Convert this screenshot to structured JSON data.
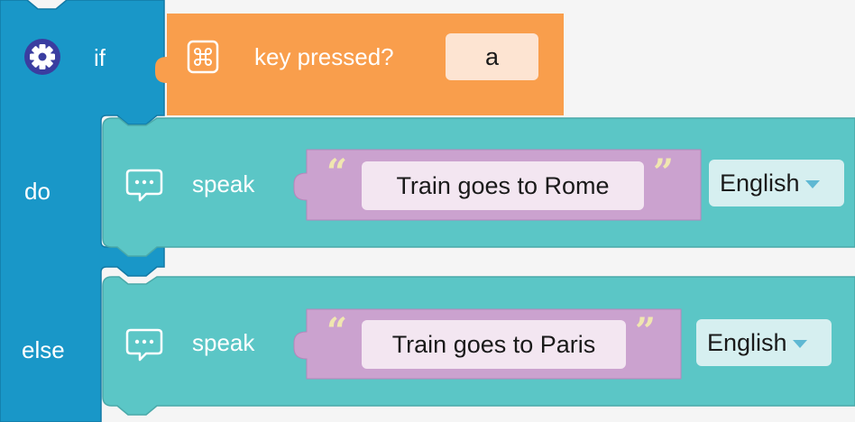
{
  "colors": {
    "workspace": "#f5f5f5",
    "if_block": "#1997c8",
    "if_block_dark": "#127aa6",
    "sensor_block": "#f99e4c",
    "sensor_field": "#fde4d2",
    "speak_block": "#5bc6c6",
    "speak_block_dark": "#4aa9a9",
    "text_block": "#cba2cf",
    "text_block_dark": "#b685bb",
    "text_field": "#f3e6f1",
    "dropdown_field": "#d6eff0"
  },
  "if_block": {
    "if_label": "if",
    "do_label": "do",
    "else_label": "else",
    "settings_icon": "gear-icon"
  },
  "condition": {
    "icon": "command-key-icon",
    "label": "key pressed?",
    "key_value": "a"
  },
  "do_branch": {
    "icon": "speech-bubble-icon",
    "speak_label": "speak",
    "open_quote": "“",
    "close_quote": "”",
    "text": "Train goes to Rome",
    "language": "English"
  },
  "else_branch": {
    "icon": "speech-bubble-icon",
    "speak_label": "speak",
    "open_quote": "“",
    "close_quote": "”",
    "text": "Train goes to Paris",
    "language": "English"
  }
}
